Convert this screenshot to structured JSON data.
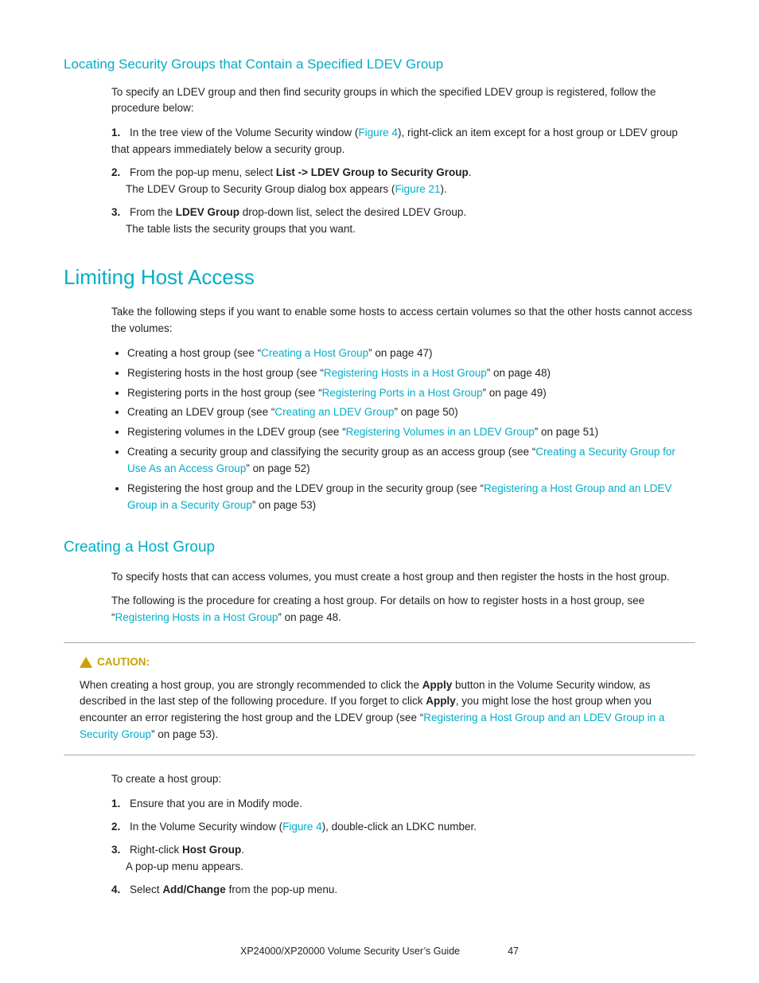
{
  "page": {
    "section1": {
      "heading": "Locating Security Groups that Contain a Specified LDEV Group",
      "intro": "To specify an LDEV group and then find security groups in which the specified LDEV group is registered, follow the procedure below:",
      "steps": [
        {
          "num": "1.",
          "text": "In the tree view of the Volume Security window (",
          "link_text": "Figure 4",
          "text2": "), right-click an item except for a host group or LDEV group that appears immediately below a security group."
        },
        {
          "num": "2.",
          "text_before": "From the pop-up menu, select ",
          "bold": "List -> LDEV Group to Security Group",
          "text_after": ".",
          "sub_text": "The LDEV Group to Security Group dialog box appears (",
          "sub_link": "Figure 21",
          "sub_text2": ")."
        },
        {
          "num": "3.",
          "text_before": "From the ",
          "bold1": "LDEV Group",
          "text_mid": " drop-down list, select the desired LDEV Group.",
          "sub_text": "The table lists the security groups that you want."
        }
      ]
    },
    "section2": {
      "heading": "Limiting Host Access",
      "intro": "Take the following steps if you want to enable some hosts to access certain volumes so that the other hosts cannot access the volumes:",
      "bullets": [
        {
          "text": "Creating a host group (see “",
          "link_text": "Creating a Host Group",
          "text2": "” on page 47)"
        },
        {
          "text": "Registering hosts in the host group (see “",
          "link_text": "Registering Hosts in a Host Group",
          "text2": "” on page 48)"
        },
        {
          "text": "Registering ports in the host group (see “",
          "link_text": "Registering Ports in a Host Group",
          "text2": "” on page 49)"
        },
        {
          "text": "Creating an LDEV group (see “",
          "link_text": "Creating an LDEV Group",
          "text2": "” on page 50)"
        },
        {
          "text": "Registering volumes in the LDEV group (see “",
          "link_text": "Registering Volumes in an LDEV Group",
          "text2": "” on page 51)"
        },
        {
          "text": "Creating a security group and classifying the security group as an access group (see “",
          "link_text": "Creating a Security Group for Use As an Access Group",
          "text2": "” on page 52)"
        },
        {
          "text": "Registering the host group and the LDEV group in the security group (see “",
          "link_text": "Registering a Host Group and an LDEV Group in a Security Group",
          "text2": "” on page 53)"
        }
      ]
    },
    "section3": {
      "heading": "Creating a Host Group",
      "para1": "To specify hosts that can access volumes, you must create a host group and then register the hosts in the host group.",
      "para2_before": "The following is the procedure for creating a host group. For details on how to register hosts in a host group, see “",
      "para2_link": "Registering Hosts in a Host Group",
      "para2_after": "” on page 48.",
      "caution": {
        "title": "CAUTION:",
        "text_before": "When creating a host group, you are strongly recommended to click the ",
        "bold1": "Apply",
        "text_mid": " button in the Volume Security window, as described in the last step of the following procedure. If you forget to click ",
        "bold2": "Apply",
        "text_after": ", you might lose the host group when you encounter an error registering the host group and the LDEV group (see “",
        "link_text": "Registering a Host Group and an LDEV Group in a Security Group",
        "text_end": "” on page 53)."
      },
      "create_intro": "To create a host group:",
      "steps": [
        {
          "num": "1.",
          "text": "Ensure that you are in Modify mode."
        },
        {
          "num": "2.",
          "text_before": "In the Volume Security window (",
          "link_text": "Figure 4",
          "text_after": "), double-click an LDKC number."
        },
        {
          "num": "3.",
          "text_before": "Right-click ",
          "bold": "Host Group",
          "text_after": ".",
          "sub_text": "A pop-up menu appears."
        },
        {
          "num": "4.",
          "text_before": "Select ",
          "bold": "Add/Change",
          "text_after": " from the pop-up menu."
        }
      ]
    },
    "footer": {
      "doc_title": "XP24000/XP20000 Volume Security User’s Guide",
      "page_number": "47"
    }
  }
}
